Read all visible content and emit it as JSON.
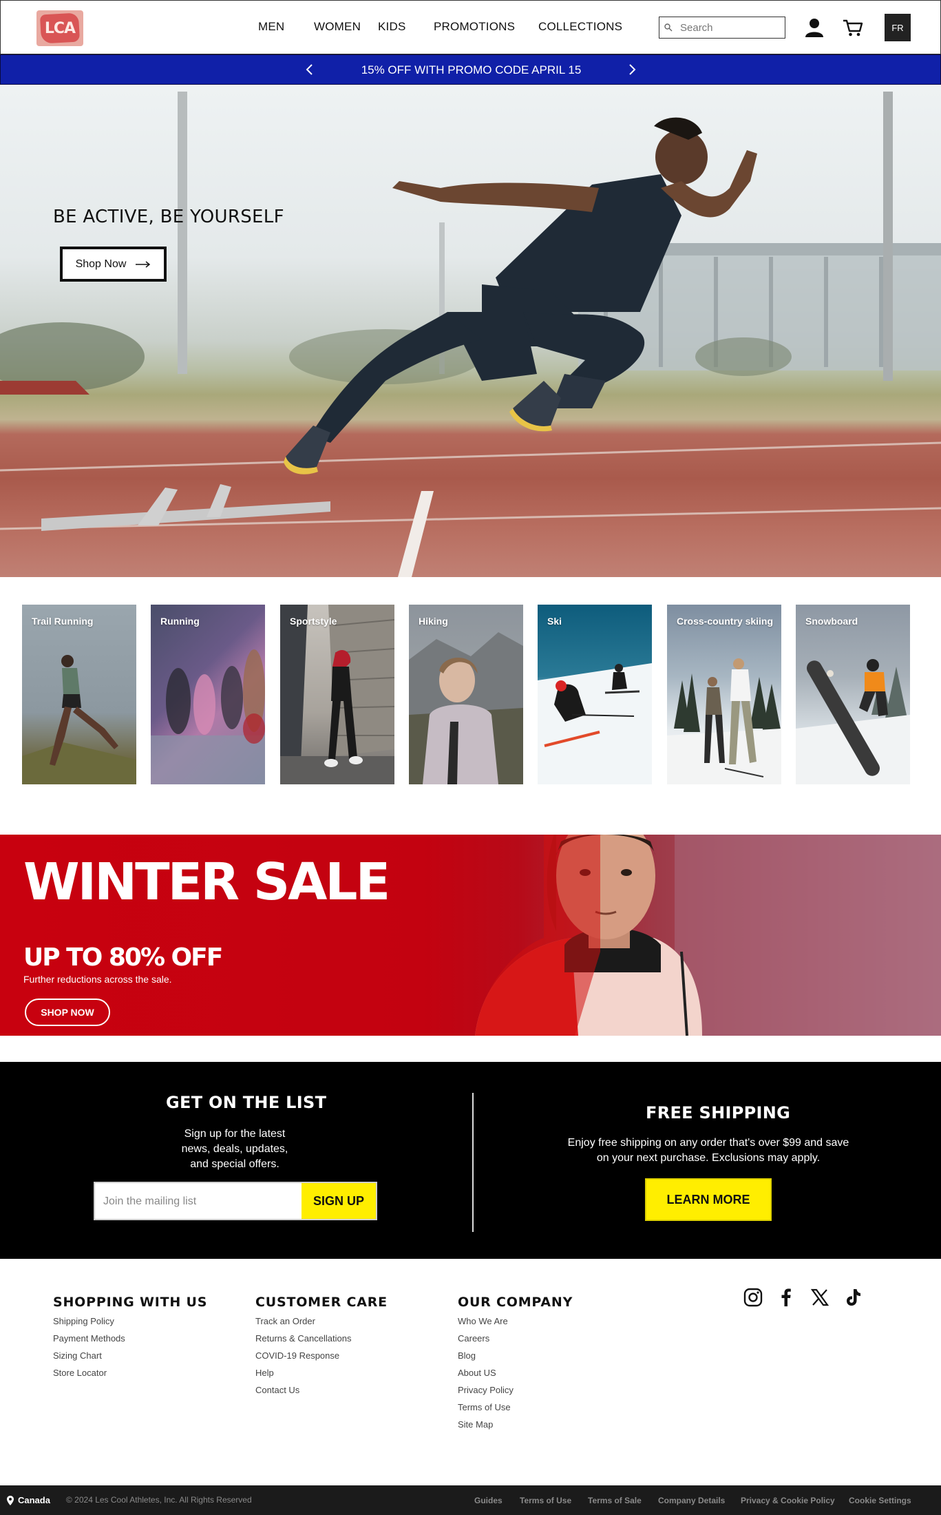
{
  "header": {
    "logo_text": "LCA",
    "nav": [
      "MEN",
      "WOMEN",
      "KIDS",
      "PROMOTIONS",
      "COLLECTIONS"
    ],
    "search_placeholder": "Search",
    "lang_button": "FR",
    "icons": [
      "search-icon",
      "account-icon",
      "cart-icon"
    ]
  },
  "promo": {
    "text": "15%  OFF WITH PROMO CODE APRIL 15",
    "bg_color": "#1020a8"
  },
  "hero": {
    "title": "BE ACTIVE, BE YOURSELF",
    "button_label": "Shop Now"
  },
  "categories": [
    {
      "label": "Trail Running"
    },
    {
      "label": "Running"
    },
    {
      "label": "Sportstyle"
    },
    {
      "label": "Hiking"
    },
    {
      "label": "Ski"
    },
    {
      "label": "Cross-country skiing"
    },
    {
      "label": "Snowboard"
    }
  ],
  "sale": {
    "title": "WINTER SALE",
    "subtitle": "UP TO 80% OFF",
    "note": "Further reductions across the sale.",
    "button_label": "SHOP NOW",
    "bg_color": "#c8010f"
  },
  "newsletter": {
    "title": "GET ON THE LIST",
    "lines": [
      "Sign up for the latest",
      "news, deals, updates,",
      "and special offers."
    ],
    "input_placeholder": "Join the mailing list",
    "button_label": "SIGN UP",
    "accent_color": "#ffee00"
  },
  "shipping": {
    "title": "FREE SHIPPING",
    "lines": [
      "Enjoy free shipping on any order that's over $99 and save",
      "on your next purchase. Exclusions may apply."
    ],
    "button_label": "LEARN MORE"
  },
  "footer": {
    "columns": [
      {
        "title": "SHOPPING WITH US",
        "links": [
          "Shipping Policy",
          "Payment Methods",
          "Sizing Chart",
          "Store Locator"
        ]
      },
      {
        "title": "CUSTOMER CARE",
        "links": [
          "Track an Order",
          "Returns & Cancellations",
          "COVID-19 Response",
          "Help",
          "Contact Us"
        ]
      },
      {
        "title": "OUR COMPANY",
        "links": [
          "Who We Are",
          "Careers",
          "Blog",
          "About US",
          "Privacy Policy",
          "Terms of Use",
          "Site Map"
        ]
      }
    ],
    "social_icons": [
      "instagram-icon",
      "facebook-icon",
      "x-icon",
      "tiktok-icon"
    ]
  },
  "bottom_bar": {
    "country": "Canada",
    "copyright": "© 2024 Les Cool Athletes, Inc. All Rights Reserved",
    "links": [
      "Guides",
      "Terms of Use",
      "Terms of Sale",
      "Company Details",
      "Privacy & Cookie Policy",
      "Cookie Settings"
    ]
  }
}
